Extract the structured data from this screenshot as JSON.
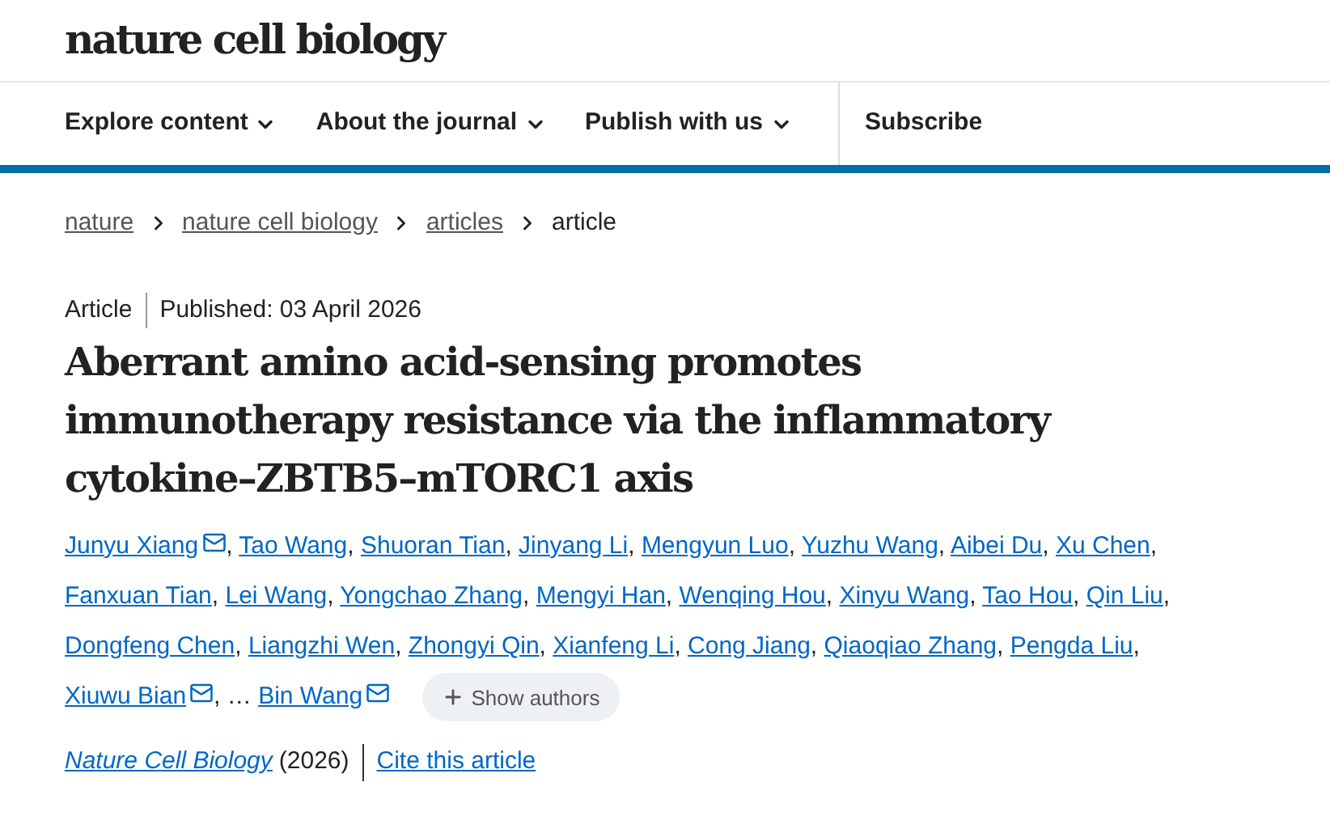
{
  "logo": "nature cell biology",
  "nav": [
    {
      "label": "Explore content",
      "dropdown": true
    },
    {
      "label": "About the journal",
      "dropdown": true
    },
    {
      "label": "Publish with us",
      "dropdown": true
    },
    {
      "label": "Subscribe",
      "dropdown": false
    }
  ],
  "breadcrumbs": [
    {
      "label": "nature",
      "link": true
    },
    {
      "label": "nature cell biology",
      "link": true
    },
    {
      "label": "articles",
      "link": true
    },
    {
      "label": "article",
      "link": false
    }
  ],
  "article_type": "Article",
  "published": "Published: 03 April 2026",
  "title": "Aberrant amino acid-sensing promotes immunotherapy resistance via the inflammatory cytokine–ZBTB5–mTORC1 axis",
  "authors": [
    {
      "kind": "author",
      "name": "Junyu Xiang",
      "email": true,
      "suffix": ","
    },
    {
      "kind": "author",
      "name": "Tao Wang",
      "email": false,
      "suffix": ","
    },
    {
      "kind": "author",
      "name": "Shuoran Tian",
      "email": false,
      "suffix": ","
    },
    {
      "kind": "author",
      "name": "Jinyang Li",
      "email": false,
      "suffix": ","
    },
    {
      "kind": "author",
      "name": "Mengyun Luo",
      "email": false,
      "suffix": ","
    },
    {
      "kind": "author",
      "name": "Yuzhu Wang",
      "email": false,
      "suffix": ","
    },
    {
      "kind": "author",
      "name": "Aibei Du",
      "email": false,
      "suffix": ","
    },
    {
      "kind": "author",
      "name": "Xu Chen",
      "email": false,
      "suffix": ","
    },
    {
      "kind": "author",
      "name": "Fanxuan Tian",
      "email": false,
      "suffix": ","
    },
    {
      "kind": "author",
      "name": "Lei Wang",
      "email": false,
      "suffix": ","
    },
    {
      "kind": "author",
      "name": "Yongchao Zhang",
      "email": false,
      "suffix": ","
    },
    {
      "kind": "author",
      "name": "Mengyi Han",
      "email": false,
      "suffix": ","
    },
    {
      "kind": "author",
      "name": "Wenqing Hou",
      "email": false,
      "suffix": ","
    },
    {
      "kind": "author",
      "name": "Xinyu Wang",
      "email": false,
      "suffix": ","
    },
    {
      "kind": "author",
      "name": "Tao Hou",
      "email": false,
      "suffix": ","
    },
    {
      "kind": "author",
      "name": "Qin Liu",
      "email": false,
      "suffix": ","
    },
    {
      "kind": "author",
      "name": "Dongfeng Chen",
      "email": false,
      "suffix": ","
    },
    {
      "kind": "author",
      "name": "Liangzhi Wen",
      "email": false,
      "suffix": ","
    },
    {
      "kind": "author",
      "name": "Zhongyi Qin",
      "email": false,
      "suffix": ","
    },
    {
      "kind": "author",
      "name": "Xianfeng Li",
      "email": false,
      "suffix": ","
    },
    {
      "kind": "author",
      "name": "Cong Jiang",
      "email": false,
      "suffix": ","
    },
    {
      "kind": "author",
      "name": "Qiaoqiao Zhang",
      "email": false,
      "suffix": ","
    },
    {
      "kind": "author",
      "name": "Pengda Liu",
      "email": false,
      "suffix": ","
    },
    {
      "kind": "author",
      "name": "Xiuwu Bian",
      "email": true,
      "suffix": ","
    },
    {
      "kind": "gap",
      "name": "…"
    },
    {
      "kind": "author",
      "name": "Bin Wang",
      "email": true
    }
  ],
  "show_authors": "Show authors",
  "journal": "Nature Cell Biology",
  "year": "(2026)",
  "cite": "Cite this article"
}
